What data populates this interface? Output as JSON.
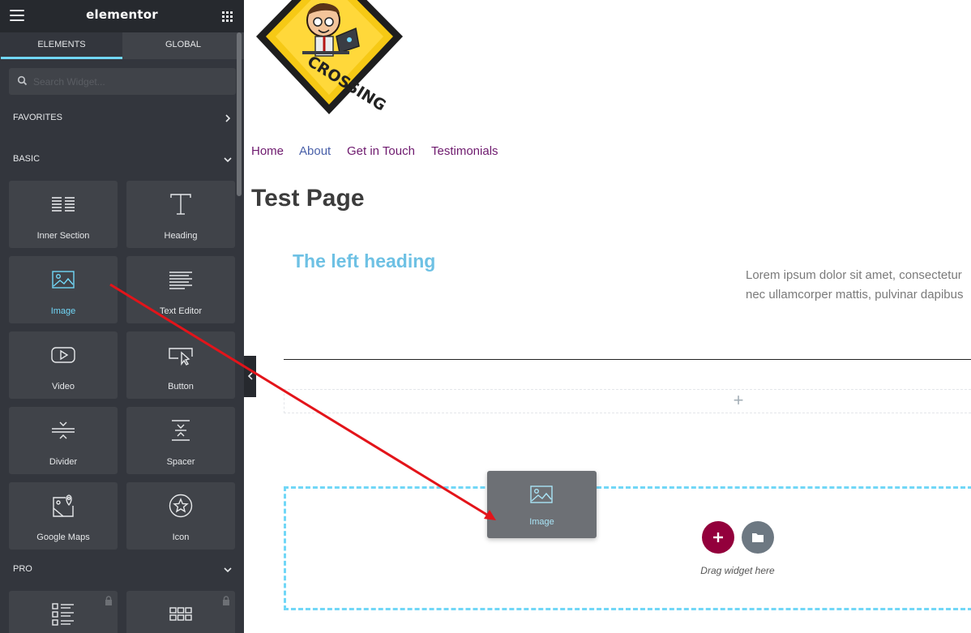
{
  "sidebar": {
    "logo": "elementor",
    "tabs": [
      {
        "label": "ELEMENTS"
      },
      {
        "label": "GLOBAL"
      }
    ],
    "search": {
      "placeholder": "Search Widget...",
      "value": ""
    },
    "categories": {
      "favorites": "FAVORITES",
      "basic": "BASIC",
      "pro": "PRO"
    },
    "basic_widgets": [
      {
        "label": "Inner Section",
        "icon": "inner-section-icon"
      },
      {
        "label": "Heading",
        "icon": "heading-icon"
      },
      {
        "label": "Image",
        "icon": "image-icon"
      },
      {
        "label": "Text Editor",
        "icon": "text-editor-icon"
      },
      {
        "label": "Video",
        "icon": "video-icon"
      },
      {
        "label": "Button",
        "icon": "button-icon"
      },
      {
        "label": "Divider",
        "icon": "divider-icon"
      },
      {
        "label": "Spacer",
        "icon": "spacer-icon"
      },
      {
        "label": "Google Maps",
        "icon": "google-maps-icon"
      },
      {
        "label": "Icon",
        "icon": "star-icon"
      }
    ],
    "pro_widgets": [
      {
        "icon": "posts-icon",
        "locked": true
      },
      {
        "icon": "portfolio-icon",
        "locked": true
      }
    ],
    "accent_color": "#71d7f7"
  },
  "page": {
    "nav": [
      "Home",
      "About",
      "Get in Touch",
      "Testimonials"
    ],
    "title": "Test Page",
    "left_heading": "The left heading",
    "lorem": [
      "Lorem ipsum dolor sit amet, consectetur",
      "nec ullamcorper mattis, pulvinar dapibus"
    ],
    "drop_zone_hint": "Drag widget here",
    "add_section_icon": "plus-icon"
  },
  "drag_ghost": {
    "label": "Image",
    "icon": "image-icon"
  },
  "colors": {
    "sidebar_bg": "#33363d",
    "tile_bg": "#404349",
    "add_button": "#93003c",
    "template_button": "#6d7882",
    "annotation_arrow": "#e3141a"
  }
}
